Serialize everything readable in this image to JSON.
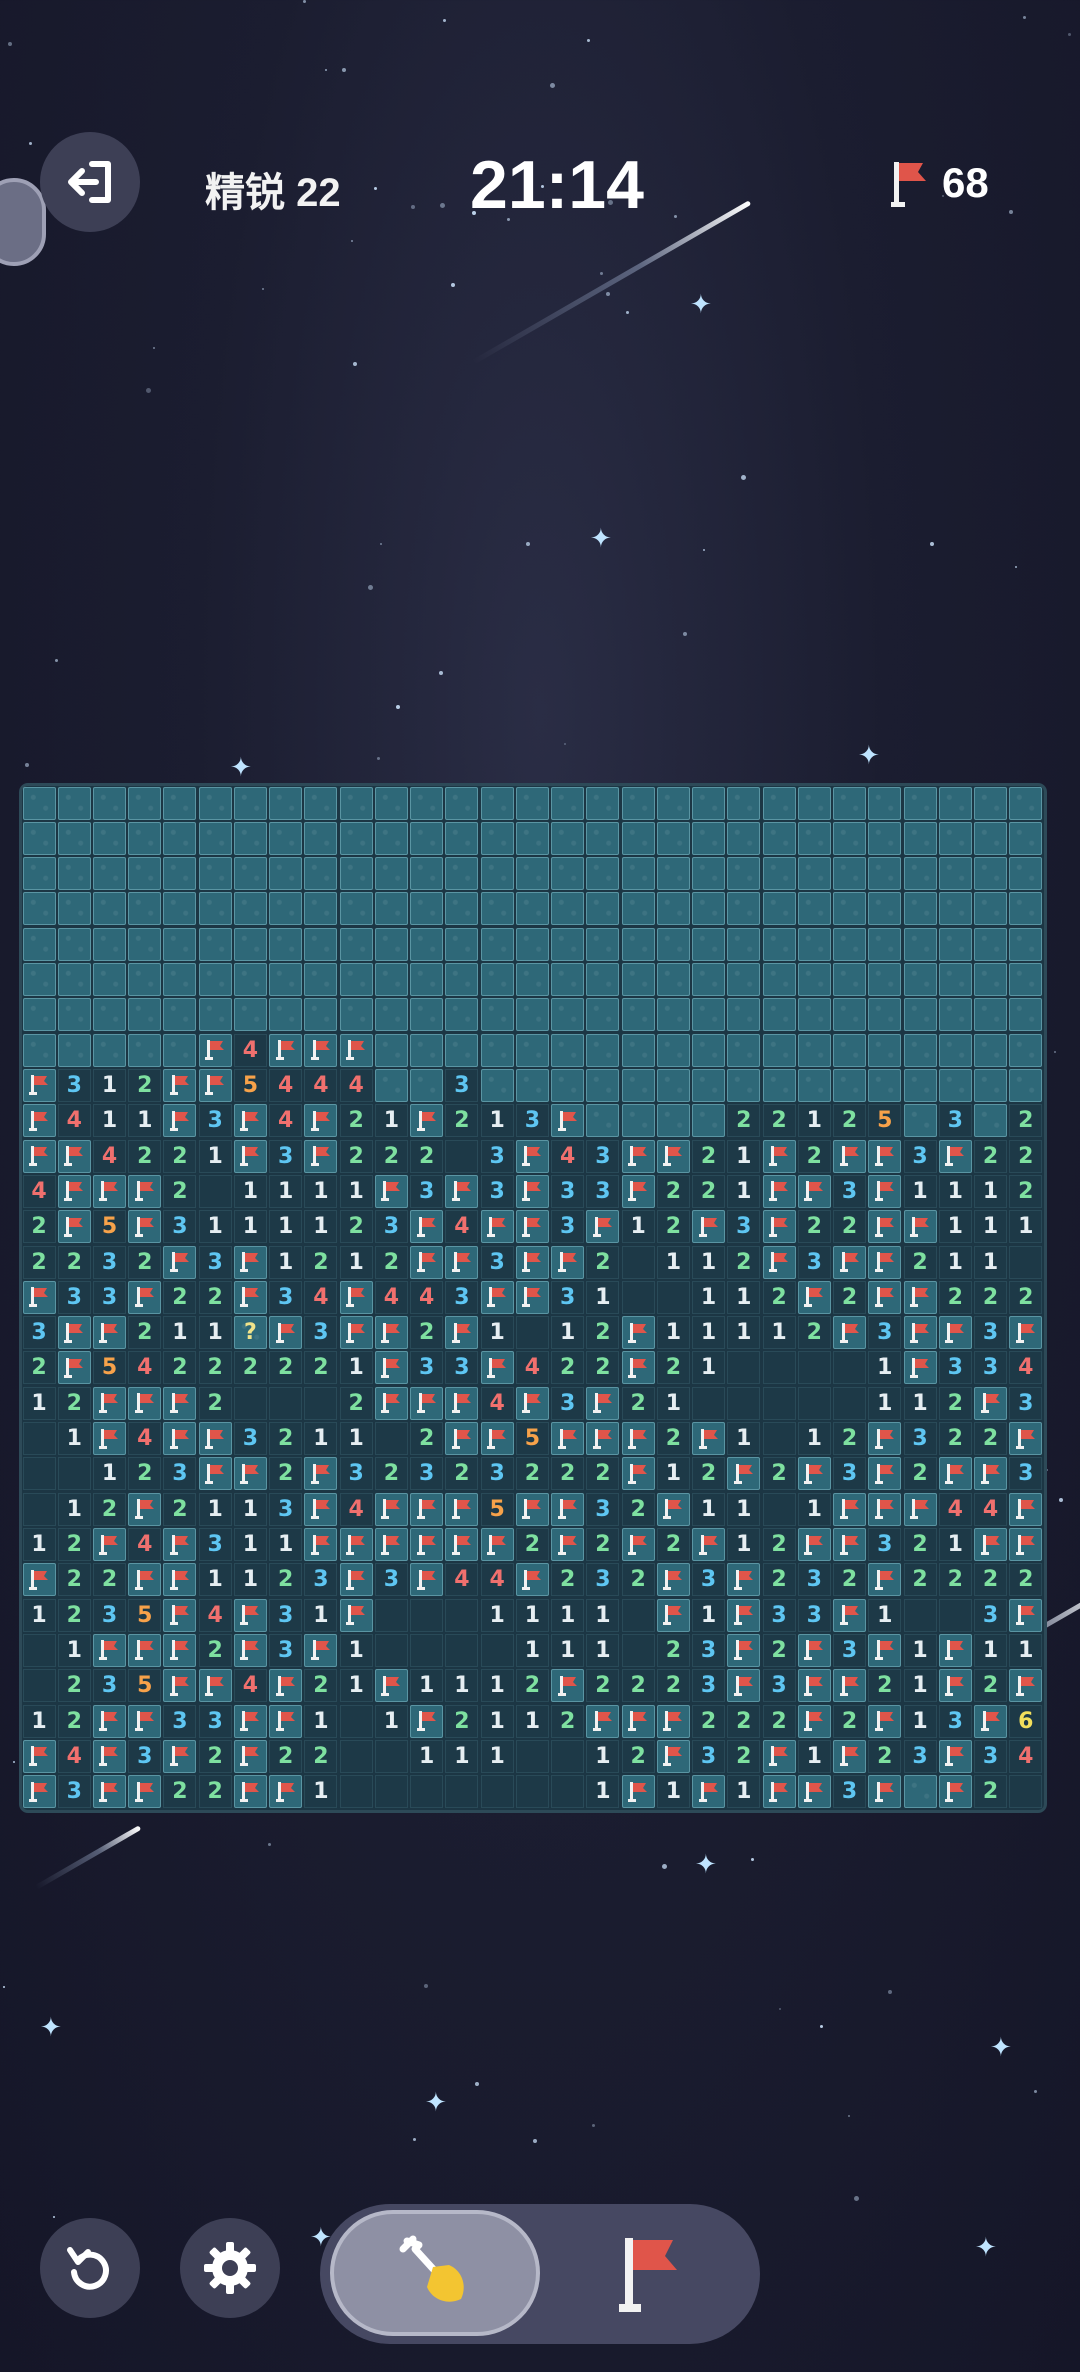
{
  "header": {
    "level_label": "精锐 22",
    "timer": "21:14",
    "flags_remaining": "68",
    "exit_icon": "exit-icon",
    "flag_icon": "flag-icon"
  },
  "board": {
    "columns": 29,
    "rows": 29,
    "legend": {
      "#": "covered",
      "F": "flag",
      ".": "revealed-empty",
      "?": "question-mark",
      "1-6": "revealed-number"
    },
    "grid": [
      "#############################",
      "#############################",
      "#############################",
      "#############################",
      "#############################",
      "#############################",
      "#############################",
      "#####F4FFF###################",
      "F312FF5444##3################",
      "F411F3F4F21F213F####22125#3#2",
      "FF4221F3F222.3F43FF21F2FF3F22",
      "4FFF2.1111F3F3F33F221FF3F1112F",
      "2F5F3111123F4FF3F12F3F22FF111",
      "2232F3F1212FF3FF2.112F3FF211",
      "F33F22F34F443FF31..112F2FF22221",
      "3FF211?F3FF2F1.12F11112F3FF3F3",
      "2F54222221F33F422F21....1F3344FF",
      "12FFF2...2FFF4F3F21.....112F3F3F2",
      ".1F4FF3211.2FF5FFF2F1.12F322F3F542",
      "..123FF2F32323222F12F2F3F2FF34FFFFF",
      ".12F2113F4FFF5FF32F11.1FFF44FF4FF4F32",
      "12F4F311FFFFFF2F2F2F12FF321FF4F11",
      "F22FF1123F3F44F232F3F232F2222213F4F1",
      "1235F4F31F...1111.F1F33F1..3FFF1",
      ".1FFF2F3F1....111.23F2F3F1F1113FF4F3F11",
      ".235FF4F21F1112F2223F3FF21F2F4F3F2F2F32",
      "12FF33FF1.1F2112FFF222F2F13F6F3F323FF",
      "F4F3F2F22..111..12F32F1F23F34FF3F2FF",
      "F3FF22FF1.......1F1F1FF3F#F2..13F"
    ]
  },
  "controls": {
    "undo_icon": "undo-icon",
    "settings_icon": "gear-icon",
    "dig_mode_icon": "shovel-icon",
    "flag_mode_icon": "flag-icon",
    "active_mode": "dig"
  }
}
